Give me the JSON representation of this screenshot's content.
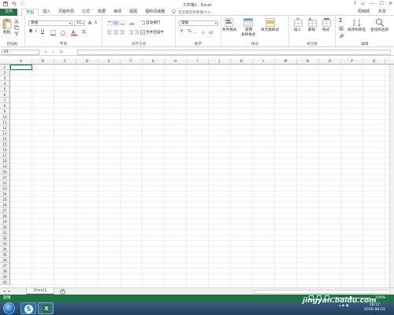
{
  "app": {
    "title": "工作簿1 - Excel",
    "user": "周雨晴",
    "share": "共享"
  },
  "window_buttons": [
    "?",
    "▭",
    "—",
    "☐",
    "✕"
  ],
  "tabs": {
    "file": "文件",
    "items": [
      "开始",
      "插入",
      "页面布局",
      "公式",
      "数据",
      "审阅",
      "视图",
      "福昕阅读器"
    ],
    "active_index": 0,
    "tellme": "告诉我您想要做什么..."
  },
  "ribbon": {
    "clipboard": {
      "label": "剪贴板",
      "paste": "粘贴"
    },
    "font": {
      "label": "字体",
      "font_name": "等线",
      "font_size": "11",
      "grow": "A",
      "shrink": "A",
      "bold": "B",
      "italic": "I",
      "underline": "U",
      "wen": "文"
    },
    "alignment": {
      "label": "对齐方式",
      "wrap": "自动换行",
      "merge": "合并后居中"
    },
    "number": {
      "label": "数字",
      "format": "常规",
      "currency": "¥",
      "percent": "%",
      "comma": ","
    },
    "styles": {
      "label": "样式",
      "conditional": "条件格式",
      "table": "套用",
      "table2": "表格格式",
      "cell_styles": "单元格样式"
    },
    "cells": {
      "label": "单元格",
      "insert": "插入",
      "delete": "删除",
      "format": "格式"
    },
    "editing": {
      "label": "编辑",
      "sort": "排序和筛选",
      "find": "查找和选择"
    }
  },
  "formula_bar": {
    "name_box": "A1",
    "cancel": "×",
    "enter": "✓",
    "fx": "fx"
  },
  "grid": {
    "columns": [
      "A",
      "B",
      "C",
      "D",
      "E",
      "F",
      "G",
      "H",
      "I",
      "J",
      "K",
      "L",
      "M",
      "N",
      "O",
      "P",
      "Q"
    ],
    "rows": [
      "1",
      "2",
      "3",
      "4",
      "5",
      "6",
      "7",
      "8",
      "9",
      "10",
      "11",
      "12",
      "13",
      "14",
      "15",
      "16",
      "17",
      "18",
      "19",
      "20",
      "21",
      "22",
      "23",
      "24",
      "25",
      "26",
      "27",
      "28",
      "29",
      "30",
      "31",
      "32",
      "33",
      "34",
      "35",
      "36",
      "37",
      "38",
      "39",
      "40"
    ]
  },
  "sheet_tabs": {
    "sheets": [
      "Sheet1"
    ],
    "add": "+"
  },
  "status": {
    "text": "就绪",
    "zoom": "100%",
    "zoom_level": 1.0
  },
  "taskbar": {
    "time": "18:17",
    "date": "2016-08-03",
    "s_icon": "S",
    "x_icon": "X"
  },
  "watermark": "jingyan.baidu.com",
  "colors": {
    "accent": "#217346",
    "taskbar": "#233f5c"
  }
}
